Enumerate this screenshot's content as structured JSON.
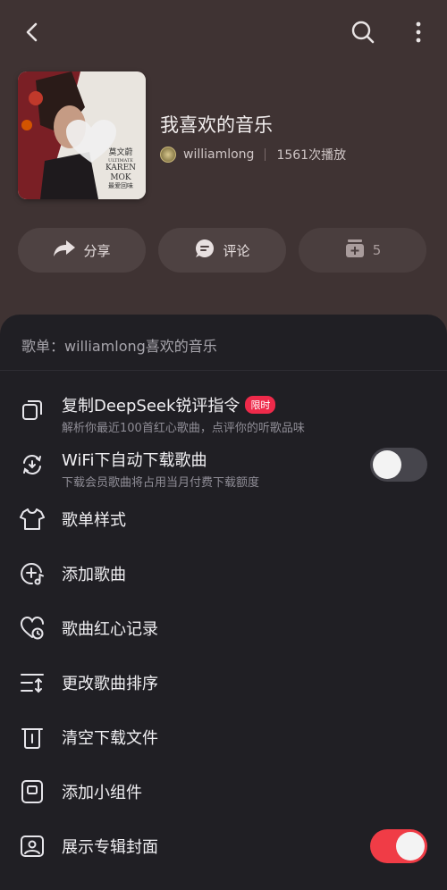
{
  "playlist": {
    "title": "我喜欢的音乐",
    "owner": "williamlong",
    "plays": "1561次播放",
    "cover_text": {
      "line1": "莫文蔚",
      "line2": "ULTIMATE",
      "line3": "KAREN MOK",
      "line4": "最爱回味"
    }
  },
  "actions": {
    "share": "分享",
    "comment": "评论",
    "add_count": "5"
  },
  "sheet": {
    "header": "歌单：williamlong喜欢的音乐",
    "items": [
      {
        "label": "复制DeepSeek锐评指令",
        "badge": "限时",
        "sub": "解析你最近100首红心歌曲，点评你的听歌品味"
      },
      {
        "label": "WiFi下自动下载歌曲",
        "sub": "下载会员歌曲将占用当月付费下载额度",
        "toggle": false
      },
      {
        "label": "歌单样式"
      },
      {
        "label": "添加歌曲"
      },
      {
        "label": "歌曲红心记录"
      },
      {
        "label": "更改歌曲排序"
      },
      {
        "label": "清空下载文件"
      },
      {
        "label": "添加小组件"
      },
      {
        "label": "展示专辑封面",
        "toggle": true
      }
    ]
  },
  "colors": {
    "accent": "#f03c46",
    "badge": "#ee2a4a"
  }
}
